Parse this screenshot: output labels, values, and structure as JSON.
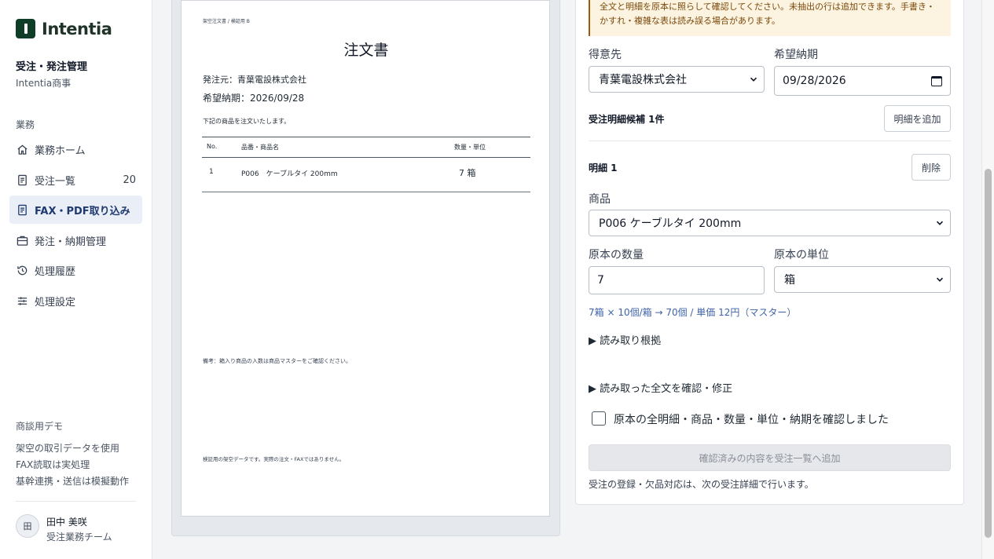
{
  "brand": {
    "name": "Intentia"
  },
  "org": {
    "title": "受注・発注管理",
    "subtitle": "Intentia商事"
  },
  "sidebar": {
    "section_label": "業務",
    "items": [
      {
        "label": "業務ホーム",
        "icon": "home-icon"
      },
      {
        "label": "受注一覧",
        "icon": "document-icon",
        "count": "20"
      },
      {
        "label": "FAX・PDF取り込み",
        "icon": "document-icon",
        "active": true
      },
      {
        "label": "発注・納期管理",
        "icon": "briefcase-icon"
      },
      {
        "label": "処理履歴",
        "icon": "history-icon"
      },
      {
        "label": "処理設定",
        "icon": "sliders-icon"
      }
    ],
    "demo": {
      "title": "商談用デモ",
      "lines": [
        "架空の取引データを使用",
        "FAX読取は実処理",
        "基幹連携・送信は模擬動作"
      ]
    },
    "user": {
      "initial": "田",
      "name": "田中 美咲",
      "team": "受注業務チーム"
    }
  },
  "document": {
    "header_small": "架空注文書 / 検証用 B",
    "title": "注文書",
    "issuer": "発注元：青葉電設株式会社",
    "due": "希望納期：2026/09/28",
    "intro": "下記の商品を注文いたします。",
    "table": {
      "headers": [
        "No.",
        "品番・商品名",
        "数量・単位"
      ],
      "rows": [
        [
          "1",
          "P006　ケーブルタイ 200mm",
          "7 箱"
        ]
      ]
    },
    "remark": "備考：箱入り商品の入数は商品マスターをご確認ください。",
    "footer": "検証用の架空データです。実際の注文・FAXではありません。"
  },
  "form": {
    "notice": "全文と明細を原本に照らして確認してください。未抽出の行は追加できます。手書き・かすれ・複雑な表は読み誤る場合があります。",
    "customer_label": "得意先",
    "customer_value": "青葉電設株式会社",
    "due_label": "希望納期",
    "due_value": "09/28/2026",
    "lines_heading": "受注明細候補 1件",
    "add_line_button": "明細を追加",
    "line_title": "明細 1",
    "delete_button": "削除",
    "product_label": "商品",
    "product_value": "P006 ケーブルタイ 200mm",
    "qty_label": "原本の数量",
    "qty_value": "7",
    "unit_label": "原本の単位",
    "unit_value": "箱",
    "conversion_text": "7箱 × 10個/箱 → 70個 / 単価 12円（マスター）",
    "evidence_toggle": "▶ 読み取り根拠",
    "fulltext_toggle": "▶ 読み取った全文を確認・修正",
    "confirm_checkbox_label": "原本の全明細・商品・数量・単位・納期を確認しました",
    "submit_button": "確認済みの内容を受注一覧へ追加",
    "footer_note": "受注の登録・欠品対応は、次の受注詳細で行います。"
  },
  "colors": {
    "brand": "#0f3d27",
    "active_nav_bg": "#e9eef7",
    "active_nav_text": "#1e3a6e",
    "notice_bg": "#fdf3e1",
    "notice_text": "#7a4a0c",
    "link": "#3f64a8"
  }
}
